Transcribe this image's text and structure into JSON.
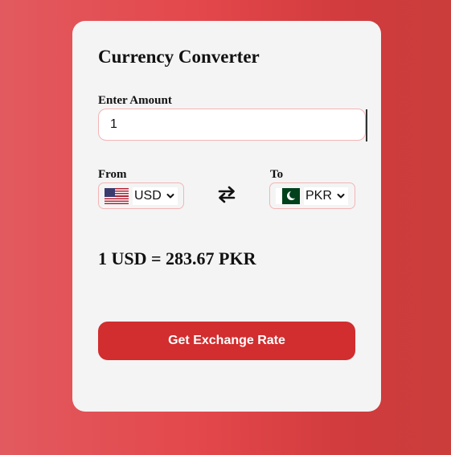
{
  "converter": {
    "title": "Currency Converter",
    "amount_label": "Enter Amount",
    "amount_value": "1",
    "from_label": "From",
    "to_label": "To",
    "from_currency": "USD",
    "to_currency": "PKR",
    "from_flag_icon": "us-flag-icon",
    "to_flag_icon": "pk-flag-icon",
    "swap_icon": "swap-arrows-icon",
    "result_text": "1 USD = 283.67 PKR",
    "button_label": "Get Exchange Rate"
  },
  "colors": {
    "accent": "#d22d2f",
    "card_background": "#f4f4f4",
    "input_border": "#f3b5b5",
    "page_gradient_start": "#e25a5f",
    "page_gradient_end": "#c93d3b"
  }
}
